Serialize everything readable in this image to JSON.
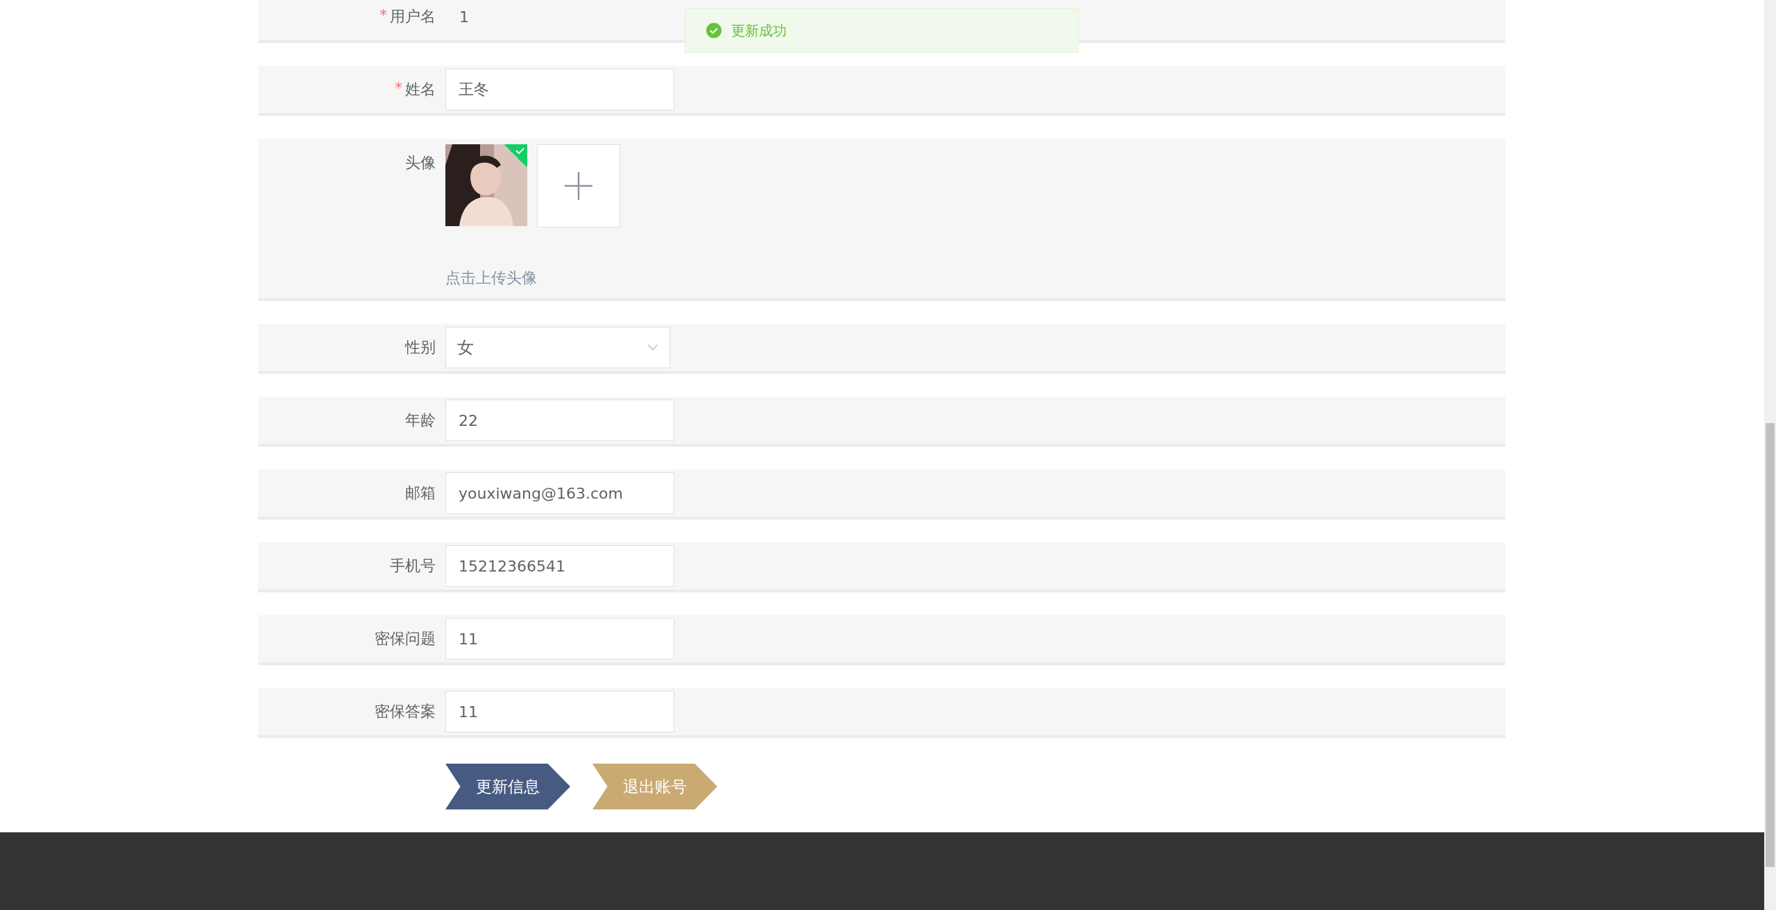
{
  "toast": {
    "kind": "success",
    "message": "更新成功"
  },
  "form": {
    "fields": [
      {
        "kind": "text",
        "label": "用户名",
        "required_mark": "*",
        "value": "1"
      },
      {
        "kind": "input",
        "label": "姓名",
        "required_mark": "*",
        "value": "王冬"
      },
      {
        "kind": "avatar",
        "label": "头像",
        "uploaded": true,
        "hint": "点击上传头像"
      },
      {
        "kind": "select",
        "label": "性别",
        "value": "女"
      },
      {
        "kind": "input",
        "label": "年龄",
        "value": "22"
      },
      {
        "kind": "input",
        "label": "邮箱",
        "value": "youxiwang@163.com"
      },
      {
        "kind": "input",
        "label": "手机号",
        "value": "15212366541"
      },
      {
        "kind": "input",
        "label": "密保问题",
        "value": "11"
      },
      {
        "kind": "input",
        "label": "密保答案",
        "value": "11"
      }
    ],
    "buttons": [
      {
        "label": "更新信息",
        "kind": "primary"
      },
      {
        "label": "退出账号",
        "kind": "secondary"
      }
    ]
  }
}
